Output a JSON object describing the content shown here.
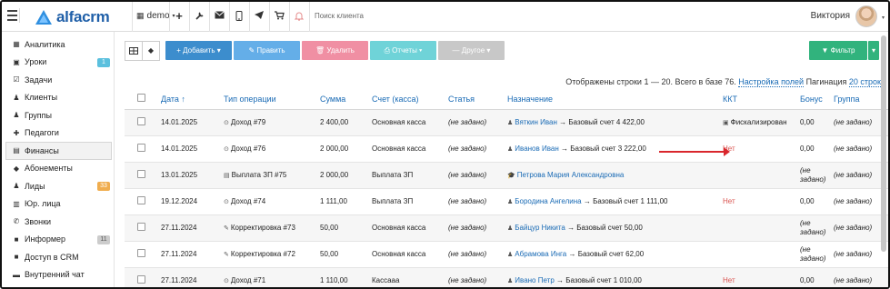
{
  "topbar": {
    "logo": "alfacrm",
    "branch": "demo",
    "search_placeholder": "Поиск клиента",
    "user_name": "Виктория",
    "icons": [
      "plus-icon",
      "wrench-icon",
      "envelope-icon",
      "mobile-icon",
      "telegram-icon",
      "cart-icon",
      "bell-icon"
    ]
  },
  "sidebar": {
    "items": [
      {
        "label": "Аналитика",
        "icon": "▦"
      },
      {
        "label": "Уроки",
        "icon": "▣",
        "badge": "1"
      },
      {
        "label": "Задачи",
        "icon": "☑"
      },
      {
        "label": "Клиенты",
        "icon": "♟"
      },
      {
        "label": "Группы",
        "icon": "♟"
      },
      {
        "label": "Педагоги",
        "icon": "✚"
      },
      {
        "label": "Финансы",
        "icon": "▤"
      },
      {
        "label": "Абонементы",
        "icon": "◆"
      },
      {
        "label": "Лиды",
        "icon": "♟",
        "badge": "33"
      },
      {
        "label": "Юр. лица",
        "icon": "▥"
      },
      {
        "label": "Звонки",
        "icon": "✆"
      },
      {
        "label": "Информер",
        "icon": "■",
        "badge": "11"
      },
      {
        "label": "Доступ в CRM",
        "icon": "■"
      },
      {
        "label": "Внутренний чат",
        "icon": "▬"
      }
    ]
  },
  "toolbar": {
    "add": "+ Добавить ▾",
    "edit": "✎ Править",
    "delete": "🗑 Удалить",
    "reports": "⎙ Отчеты ▾",
    "other": "— Другое ▾",
    "filter": "▼ Фильтр",
    "filter_caret": "▾"
  },
  "status": {
    "text": "Отображены строки 1 — 20. Всего в базе 76.",
    "settings_link": "Настройка полей",
    "pagination_label": "Пагинация",
    "pagination_value": "20 строк"
  },
  "table": {
    "headers": {
      "date": "Дата ↑",
      "optype": "Тип операции",
      "sum": "Сумма",
      "account": "Счет (касса)",
      "article": "Статья",
      "purpose": "Назначение",
      "kkt": "ККТ",
      "bonus": "Бонус",
      "group": "Группа"
    },
    "rows": [
      {
        "date": "14.01.2025",
        "optype": "Доход #79",
        "op_icon": "⊙",
        "sum": "2 400,00",
        "account": "Основная касса",
        "article": "(не задано)",
        "person": "Вяткин Иван",
        "tail": " → Базовый счет 4 422,00",
        "kkt": "Фискализирован",
        "bonus": "0,00",
        "group": "(не задано)"
      },
      {
        "date": "14.01.2025",
        "optype": "Доход #76",
        "op_icon": "⊙",
        "sum": "2 000,00",
        "account": "Основная касса",
        "article": "(не задано)",
        "person": "Иванов Иван",
        "tail": " → Базовый счет 3 222,00",
        "kkt": "Нет",
        "bonus": "0,00",
        "group": "(не задано)"
      },
      {
        "date": "13.01.2025",
        "optype": "Выплата ЗП #75",
        "op_icon": "▤",
        "sum": "2 000,00",
        "account": "Выплата ЗП",
        "article": "(не задано)",
        "person": "Петрова Мария Александровна",
        "tail": "",
        "kkt": "",
        "bonus": "(не задано)",
        "group": "(не задано)"
      },
      {
        "date": "19.12.2024",
        "optype": "Доход #74",
        "op_icon": "⊙",
        "sum": "1 111,00",
        "account": "Выплата ЗП",
        "article": "(не задано)",
        "person": "Бородина Ангелина",
        "tail": " → Базовый счет 1 111,00",
        "kkt": "Нет",
        "bonus": "0,00",
        "group": "(не задано)"
      },
      {
        "date": "27.11.2024",
        "optype": "Корректировка #73",
        "op_icon": "✎",
        "sum": "50,00",
        "account": "Основная касса",
        "article": "(не задано)",
        "person": "Байцур Никита",
        "tail": " → Базовый счет 50,00",
        "kkt": "",
        "bonus": "(не задано)",
        "group": "(не задано)"
      },
      {
        "date": "27.11.2024",
        "optype": "Корректировка #72",
        "op_icon": "✎",
        "sum": "50,00",
        "account": "Основная касса",
        "article": "(не задано)",
        "person": "Абрамова Инга",
        "tail": " → Базовый счет 62,00",
        "kkt": "",
        "bonus": "(не задано)",
        "group": "(не задано)"
      },
      {
        "date": "27.11.2024",
        "optype": "Доход #71",
        "op_icon": "⊙",
        "sum": "1 110,00",
        "account": "Кассааа",
        "article": "(не задано)",
        "person": "Ивано Петр",
        "tail": " → Базовый счет 1 010,00",
        "kkt": "Нет",
        "bonus": "0,00",
        "group": "(не задано)"
      }
    ]
  }
}
